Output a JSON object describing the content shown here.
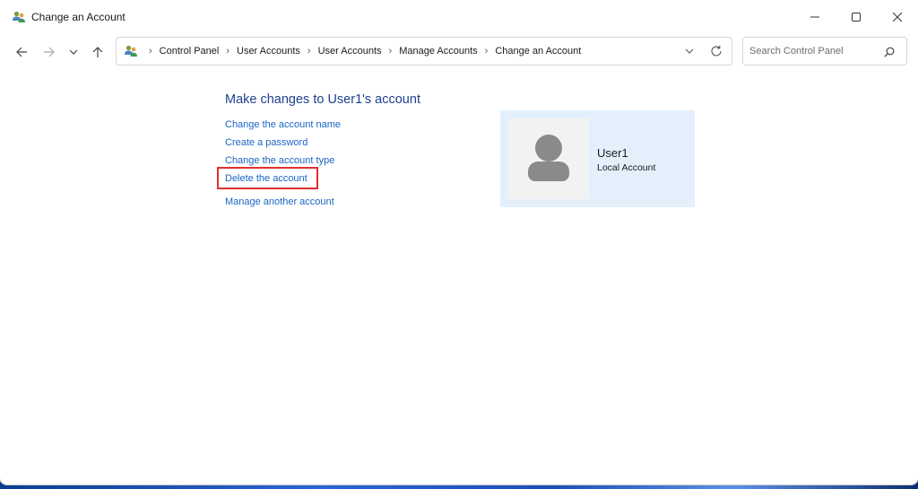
{
  "window": {
    "title": "Change an Account",
    "icon": "users-icon",
    "controls": {
      "minimize": "minimize-icon",
      "maximize": "maximize-icon",
      "close": "close-icon"
    }
  },
  "navigation": {
    "back_icon": "arrow-left-icon",
    "forward_icon": "arrow-right-icon",
    "recent_icon": "chevron-down-icon",
    "up_icon": "arrow-up-icon"
  },
  "address": {
    "breadcrumbs": [
      "Control Panel",
      "User Accounts",
      "User Accounts",
      "Manage Accounts",
      "Change an Account"
    ]
  },
  "search": {
    "placeholder": "Search Control Panel"
  },
  "main": {
    "heading": "Make changes to User1's account",
    "tasks": [
      "Change the account name",
      "Create a password",
      "Change the account type",
      "Delete the account",
      "Manage another account"
    ],
    "highlighted_task": "Delete the account"
  },
  "account": {
    "name": "User1",
    "type": "Local Account"
  },
  "colors": {
    "link": "#1a65c4",
    "heading": "#1e3f8f",
    "card_bg": "#e3f0fc",
    "highlight": "#e03030"
  }
}
